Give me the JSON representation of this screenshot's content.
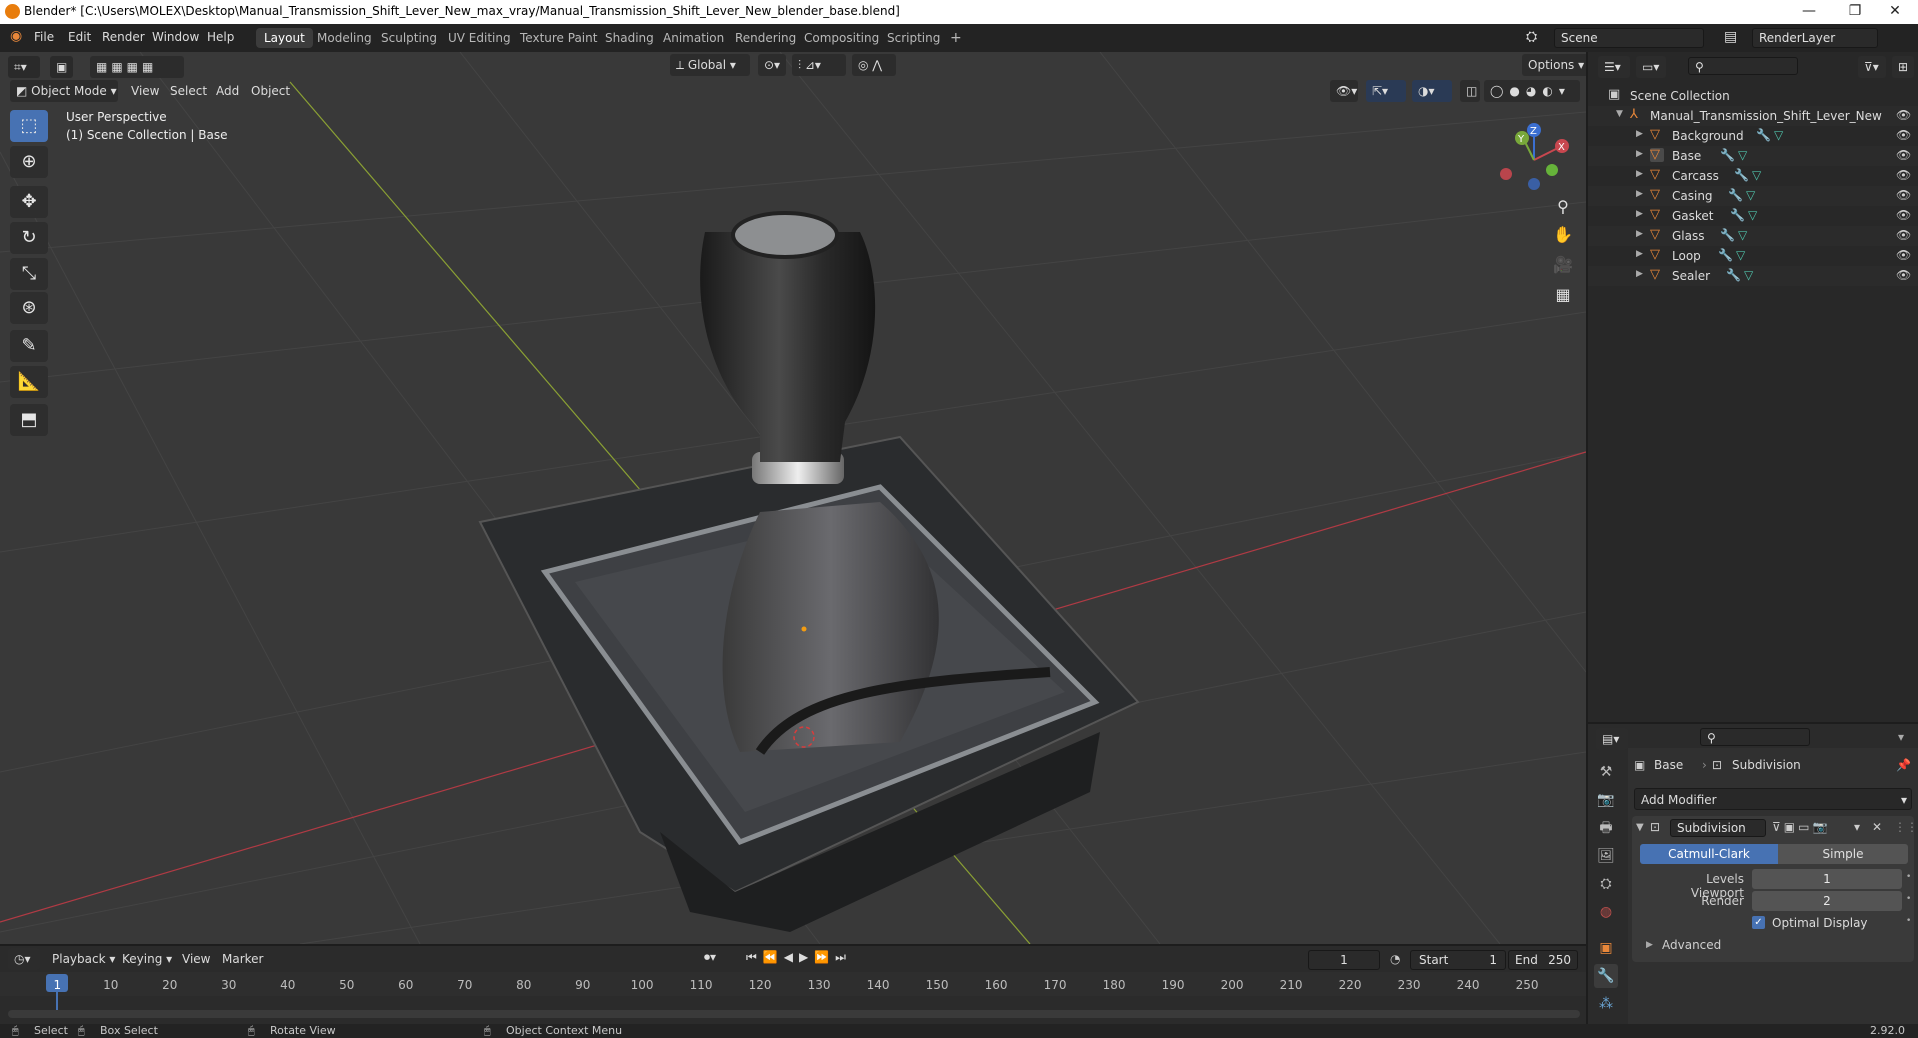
{
  "window": {
    "title": "Blender* [C:\\Users\\MOLEX\\Desktop\\Manual_Transmission_Shift_Lever_New_max_vray/Manual_Transmission_Shift_Lever_New_blender_base.blend]",
    "minimize": "—",
    "maximize": "❐",
    "close": "✕"
  },
  "menu": {
    "file": "File",
    "edit": "Edit",
    "render": "Render",
    "window": "Window",
    "help": "Help"
  },
  "workspaces": [
    "Layout",
    "Modeling",
    "Sculpting",
    "UV Editing",
    "Texture Paint",
    "Shading",
    "Animation",
    "Rendering",
    "Compositing",
    "Scripting",
    "+"
  ],
  "scene": {
    "name": "Scene",
    "render_layer": "RenderLayer"
  },
  "viewport": {
    "orientation": "Global",
    "options": "Options",
    "mode": "Object Mode",
    "menus": [
      "View",
      "Select",
      "Add",
      "Object"
    ],
    "perspective": "User Perspective",
    "collection_info": "(1) Scene Collection | Base"
  },
  "gizmo": {
    "x": "X",
    "y": "Y",
    "z": "Z"
  },
  "outliner": {
    "root": "Scene Collection",
    "collection": "Manual_Transmission_Shift_Lever_New",
    "objects": [
      "Background",
      "Base",
      "Carcass",
      "Casing",
      "Gasket",
      "Glass",
      "Loop",
      "Sealer"
    ]
  },
  "properties": {
    "object": "Base",
    "modifier_tab": "Subdivision",
    "add_modifier": "Add Modifier",
    "modifier_name": "Subdivision",
    "type_a": "Catmull-Clark",
    "type_b": "Simple",
    "levels_viewport_label": "Levels Viewport",
    "levels_viewport": "1",
    "render_label": "Render",
    "render": "2",
    "optimal_display": "Optimal Display",
    "advanced": "Advanced"
  },
  "timeline": {
    "menus": [
      "Playback",
      "Keying",
      "View",
      "Marker"
    ],
    "current": "1",
    "start_label": "Start",
    "start": "1",
    "end_label": "End",
    "end": "250",
    "ticks": [
      "1",
      "10",
      "20",
      "30",
      "40",
      "50",
      "60",
      "70",
      "80",
      "90",
      "100",
      "110",
      "120",
      "130",
      "140",
      "150",
      "160",
      "170",
      "180",
      "190",
      "200",
      "210",
      "220",
      "230",
      "240",
      "250"
    ]
  },
  "status": {
    "select": "Select",
    "box_select": "Box Select",
    "rotate": "Rotate View",
    "context": "Object Context Menu",
    "version": "2.92.0"
  },
  "colors": {
    "accent": "#4772b3",
    "orange": "#e8873a"
  }
}
